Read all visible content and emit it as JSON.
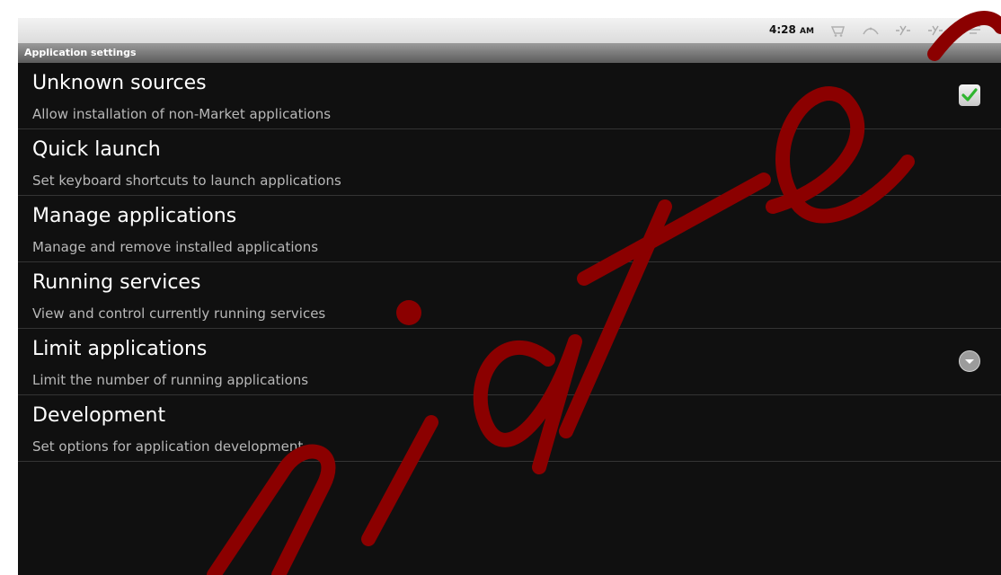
{
  "status_bar": {
    "time": "4:28",
    "ampm": "AM",
    "icons": [
      "store-icon",
      "usb-icon",
      "usb-debug-icon",
      "usb-debug-icon",
      "notification-icon"
    ]
  },
  "title_bar": {
    "title": "Application settings"
  },
  "settings": [
    {
      "title": "Unknown sources",
      "summary": "Allow installation of non-Market applications",
      "control": "checkbox",
      "checked": true
    },
    {
      "title": "Quick launch",
      "summary": "Set keyboard shortcuts to launch applications",
      "control": "none"
    },
    {
      "title": "Manage applications",
      "summary": "Manage and remove installed applications",
      "control": "none"
    },
    {
      "title": "Running services",
      "summary": "View and control currently running services",
      "control": "none"
    },
    {
      "title": "Limit applications",
      "summary": "Limit the number of running applications",
      "control": "dropdown"
    },
    {
      "title": "Development",
      "summary": "Set options for application development",
      "control": "none"
    }
  ],
  "watermark": {
    "text": "emiate",
    "color": "#8b0000"
  },
  "colors": {
    "check": "#2fb52f",
    "background": "#101010"
  }
}
